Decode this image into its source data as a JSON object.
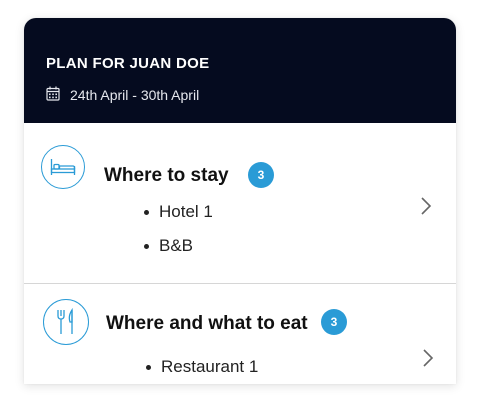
{
  "header": {
    "title": "PLAN FOR JUAN DOE",
    "date_range": "24th April - 30th April",
    "date_icon": "calendar-icon"
  },
  "sections": [
    {
      "title": "Where to stay",
      "icon": "bed-icon",
      "count": "3",
      "items": [
        "Hotel 1",
        "B&B"
      ],
      "chevron_icon": "chevron-right-icon"
    },
    {
      "title": "Where and what to eat",
      "icon": "cutlery-icon",
      "count": "3",
      "items": [
        "Restaurant 1"
      ],
      "chevron_icon": "chevron-right-icon"
    }
  ],
  "colors": {
    "header_bg": "#050b1f",
    "accent": "#2a9bd6",
    "text": "#111111"
  }
}
